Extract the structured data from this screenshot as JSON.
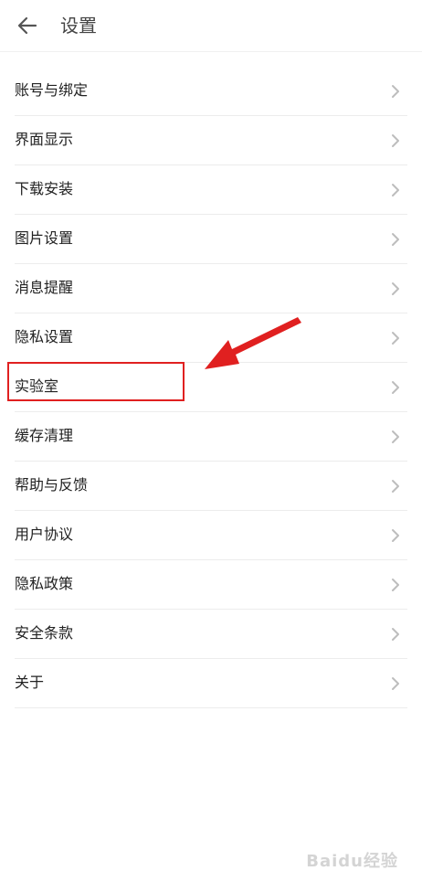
{
  "header": {
    "title": "设置",
    "back_icon": "arrow-left-icon"
  },
  "settings": {
    "items": [
      {
        "label": "账号与绑定"
      },
      {
        "label": "界面显示"
      },
      {
        "label": "下载安装"
      },
      {
        "label": "图片设置"
      },
      {
        "label": "消息提醒"
      },
      {
        "label": "隐私设置"
      },
      {
        "label": "实验室"
      },
      {
        "label": "缓存清理"
      },
      {
        "label": "帮助与反馈"
      },
      {
        "label": "用户协议"
      },
      {
        "label": "隐私政策"
      },
      {
        "label": "安全条款"
      },
      {
        "label": "关于"
      }
    ],
    "chevron_icon": "chevron-right-icon"
  },
  "annotation": {
    "highlighted_item": "实验室",
    "color": "#e02020"
  },
  "watermark": {
    "text": "Baidu经验"
  }
}
